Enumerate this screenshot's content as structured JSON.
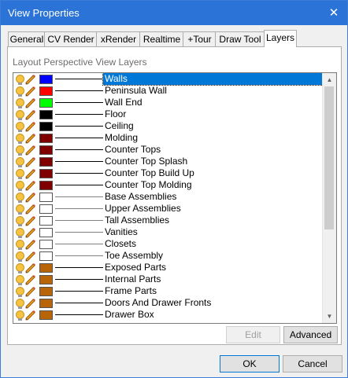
{
  "window": {
    "title": "View Properties"
  },
  "tabs": [
    {
      "label": "General",
      "active": false
    },
    {
      "label": "CV Render",
      "active": false
    },
    {
      "label": "xRender",
      "active": false
    },
    {
      "label": "Realtime",
      "active": false
    },
    {
      "label": "+Tour",
      "active": false
    },
    {
      "label": "Draw Tool",
      "active": false
    },
    {
      "label": "Layers",
      "active": true
    }
  ],
  "panel": {
    "group_label": "Layout Perspective View Layers"
  },
  "layers": [
    {
      "name": "Walls",
      "color": "#0000ff",
      "line": "#000000",
      "selected": true
    },
    {
      "name": "Peninsula Wall",
      "color": "#ff0000",
      "line": "#000000",
      "selected": false
    },
    {
      "name": "Wall End",
      "color": "#00ff00",
      "line": "#000000",
      "selected": false
    },
    {
      "name": "Floor",
      "color": "#000000",
      "line": "#000000",
      "selected": false
    },
    {
      "name": "Ceiling",
      "color": "#000000",
      "line": "#000000",
      "selected": false
    },
    {
      "name": "Molding",
      "color": "#800000",
      "line": "#000000",
      "selected": false
    },
    {
      "name": "Counter Tops",
      "color": "#800000",
      "line": "#000000",
      "selected": false
    },
    {
      "name": "Counter Top Splash",
      "color": "#800000",
      "line": "#000000",
      "selected": false
    },
    {
      "name": "Counter Top Build Up",
      "color": "#800000",
      "line": "#000000",
      "selected": false
    },
    {
      "name": "Counter Top Molding",
      "color": "#800000",
      "line": "#000000",
      "selected": false
    },
    {
      "name": "Base Assemblies",
      "color": "#ffffff",
      "line": "#808080",
      "selected": false
    },
    {
      "name": "Upper Assemblies",
      "color": "#ffffff",
      "line": "#808080",
      "selected": false
    },
    {
      "name": "Tall Assemblies",
      "color": "#ffffff",
      "line": "#808080",
      "selected": false
    },
    {
      "name": "Vanities",
      "color": "#ffffff",
      "line": "#808080",
      "selected": false
    },
    {
      "name": "Closets",
      "color": "#ffffff",
      "line": "#808080",
      "selected": false
    },
    {
      "name": "Toe Assembly",
      "color": "#ffffff",
      "line": "#808080",
      "selected": false
    },
    {
      "name": "Exposed Parts",
      "color": "#b8650a",
      "line": "#000000",
      "selected": false
    },
    {
      "name": "Internal Parts",
      "color": "#b8650a",
      "line": "#000000",
      "selected": false
    },
    {
      "name": "Frame Parts",
      "color": "#b8650a",
      "line": "#000000",
      "selected": false
    },
    {
      "name": "Doors And Drawer Fronts",
      "color": "#b8650a",
      "line": "#000000",
      "selected": false
    },
    {
      "name": "Drawer Box",
      "color": "#b8650a",
      "line": "#000000",
      "selected": false
    }
  ],
  "buttons": {
    "edit": "Edit",
    "advanced": "Advanced",
    "ok": "OK",
    "cancel": "Cancel"
  },
  "icons": {
    "close": "close-icon",
    "visibility": "lightbulb-icon",
    "edit": "pencil-icon",
    "scroll_up": "chevron-up-icon",
    "scroll_down": "chevron-down-icon"
  }
}
